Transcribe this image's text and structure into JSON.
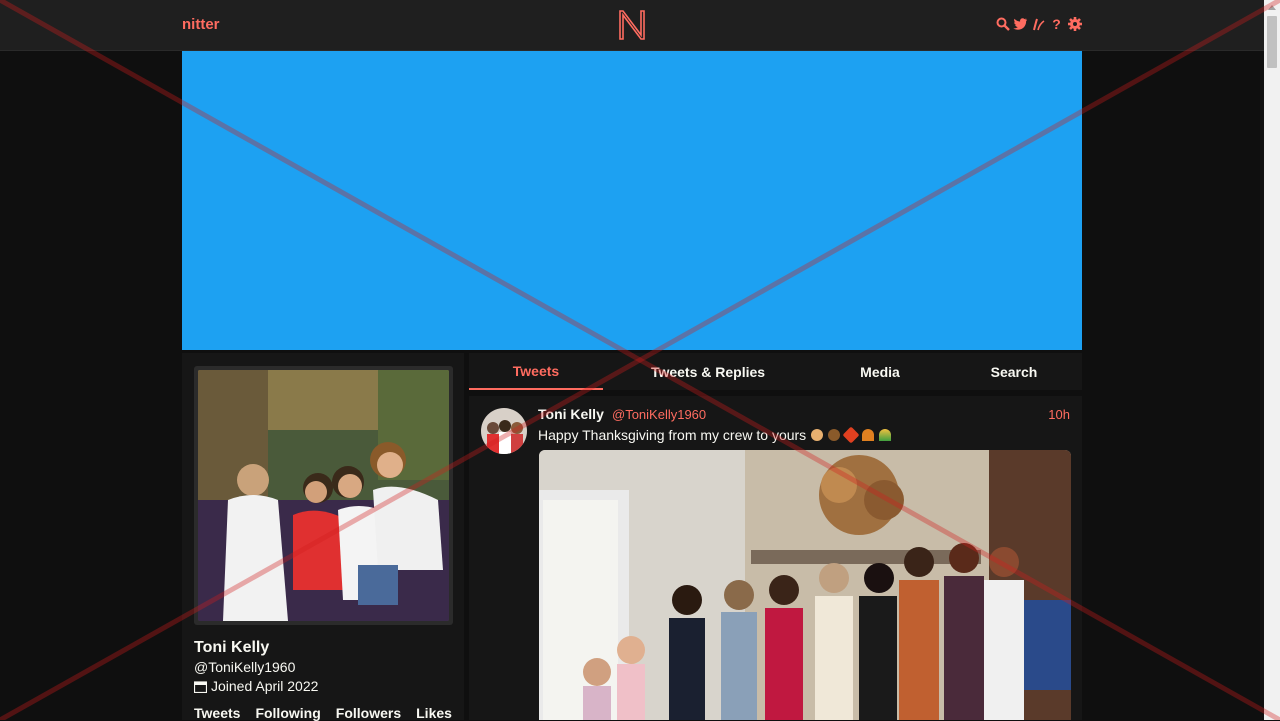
{
  "nav": {
    "brand": "nitter",
    "icons": [
      "search-icon",
      "twitter-bird-icon",
      "rss-icon",
      "help-icon",
      "gear-icon"
    ]
  },
  "banner": {
    "color": "#1da1f2"
  },
  "profile": {
    "fullname": "Toni Kelly",
    "username": "@ToniKelly1960",
    "joined": "Joined April 2022",
    "stats": [
      "Tweets",
      "Following",
      "Followers",
      "Likes"
    ]
  },
  "tabs": [
    {
      "label": "Tweets",
      "active": true
    },
    {
      "label": "Tweets & Replies",
      "active": false
    },
    {
      "label": "Media",
      "active": false
    },
    {
      "label": "Search",
      "active": false
    }
  ],
  "tweet": {
    "fullname": "Toni Kelly",
    "username": "@ToniKelly1960",
    "time": "10h",
    "text": "Happy Thanksgiving from my crew to yours"
  },
  "colors": {
    "accent": "#ff6c60",
    "background": "#0f0f0f",
    "panel": "#161616"
  }
}
